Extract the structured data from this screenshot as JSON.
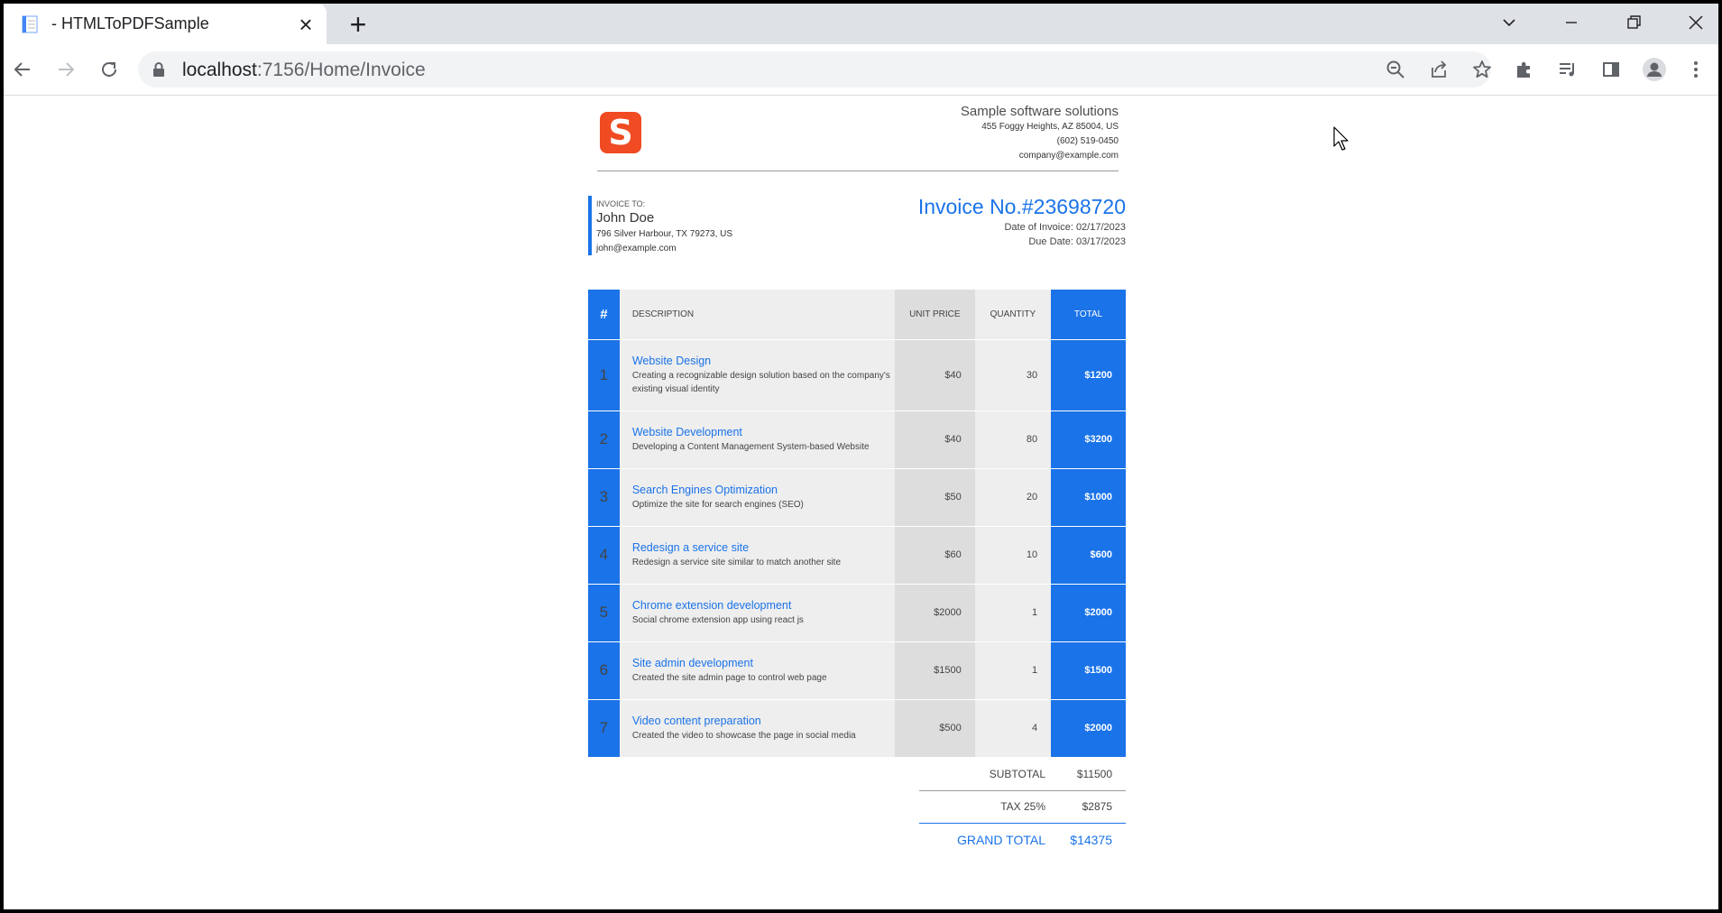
{
  "browser": {
    "tab_title": "- HTMLToPDFSample",
    "url_host": "localhost",
    "url_path": ":7156/Home/Invoice"
  },
  "company": {
    "logo_letter": "S",
    "name": "Sample software solutions",
    "address": "455 Foggy Heights, AZ 85004, US",
    "phone": "(602) 519-0450",
    "email": "company@example.com"
  },
  "bill_to": {
    "label": "INVOICE TO:",
    "name": "John Doe",
    "address": "796 Silver Harbour, TX 79273, US",
    "email": "john@example.com"
  },
  "invoice": {
    "number": "Invoice No.#23698720",
    "date": "Date of Invoice: 02/17/2023",
    "due": "Due Date: 03/17/2023"
  },
  "table": {
    "headers": {
      "num": "#",
      "description": "DESCRIPTION",
      "unit_price": "UNIT PRICE",
      "quantity": "QUANTITY",
      "total": "TOTAL"
    },
    "rows": [
      {
        "num": "1",
        "title": "Website Design",
        "desc": "Creating a recognizable design solution based on the company's existing visual identity",
        "price": "$40",
        "qty": "30",
        "total": "$1200"
      },
      {
        "num": "2",
        "title": "Website Development",
        "desc": "Developing a Content Management System-based Website",
        "price": "$40",
        "qty": "80",
        "total": "$3200"
      },
      {
        "num": "3",
        "title": "Search Engines Optimization",
        "desc": "Optimize the site for search engines (SEO)",
        "price": "$50",
        "qty": "20",
        "total": "$1000"
      },
      {
        "num": "4",
        "title": "Redesign a service site",
        "desc": "Redesign a service site similar to match another site",
        "price": "$60",
        "qty": "10",
        "total": "$600"
      },
      {
        "num": "5",
        "title": "Chrome extension development",
        "desc": "Social chrome extension app using react js",
        "price": "$2000",
        "qty": "1",
        "total": "$2000"
      },
      {
        "num": "6",
        "title": "Site admin development",
        "desc": "Created the site admin page to control web page",
        "price": "$1500",
        "qty": "1",
        "total": "$1500"
      },
      {
        "num": "7",
        "title": "Video content preparation",
        "desc": "Created the video to showcase the page in social media",
        "price": "$500",
        "qty": "4",
        "total": "$2000"
      }
    ]
  },
  "totals": {
    "subtotal_label": "SUBTOTAL",
    "subtotal": "$11500",
    "tax_label": "TAX 25%",
    "tax": "$2875",
    "grand_label": "GRAND TOTAL",
    "grand": "$14375"
  },
  "colors": {
    "accent": "#1a73e8",
    "logo": "#f04b23"
  }
}
